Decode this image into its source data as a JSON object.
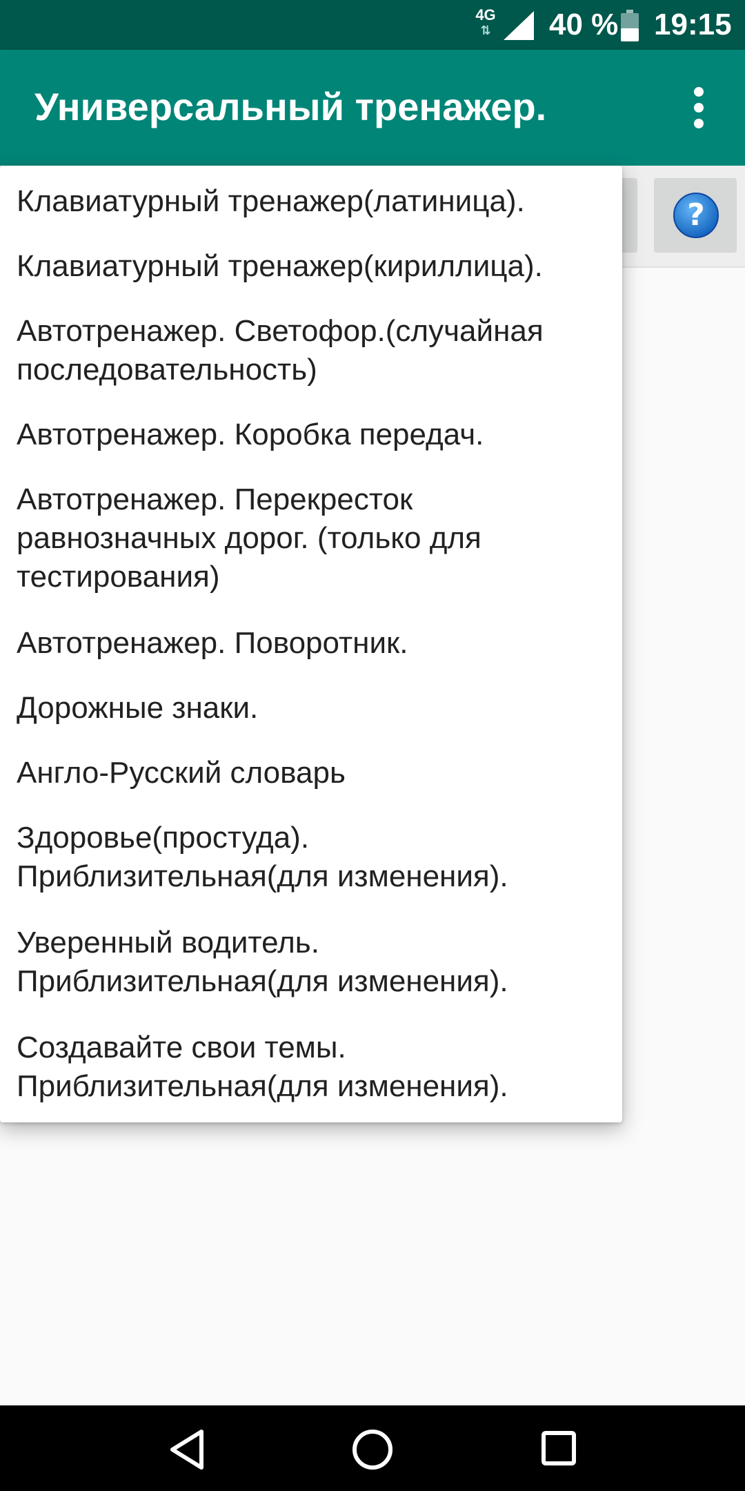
{
  "status_bar": {
    "network_type": "4G",
    "network_arrows": "⇅",
    "battery_percent": "40 %",
    "time": "19:15"
  },
  "app_bar": {
    "title": "Универсальный тренажер."
  },
  "menu": {
    "items": [
      {
        "label": "Клавиатурный тренажер(латиница)."
      },
      {
        "label": "Клавиатурный тренажер(кириллица)."
      },
      {
        "label": "Автотренажер. Светофор.(случайная последовательность)"
      },
      {
        "label": "Автотренажер. Коробка передач."
      },
      {
        "label": "Автотренажер. Перекресток равнозначных дорог. (только для тестирования)"
      },
      {
        "label": "Автотренажер. Поворотник."
      },
      {
        "label": "Дорожные знаки."
      },
      {
        "label": "Англо-Русский словарь"
      },
      {
        "label": "Здоровье(простуда). Приблизительная(для изменения)."
      },
      {
        "label": "Уверенный водитель. Приблизительная(для изменения)."
      },
      {
        "label": "Создавайте свои темы. Приблизительная(для изменения)."
      }
    ]
  },
  "colors": {
    "status_bar": "#00574B",
    "app_bar": "#008577",
    "help_icon": "#1E88E5",
    "menu_background": "#FFFFFF",
    "text": "#212121"
  },
  "icons": {
    "overflow": "more-vert-icon",
    "help": "help-question-icon",
    "signal": "signal-icon",
    "battery": "battery-icon",
    "back": "nav-back-icon",
    "home": "nav-home-icon",
    "recents": "nav-recents-icon"
  }
}
